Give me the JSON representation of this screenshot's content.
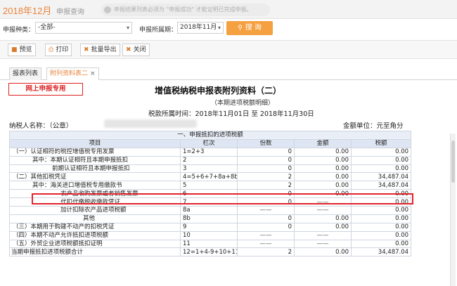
{
  "header": {
    "period": "2018年12月",
    "label": "申报查询",
    "notice": "申报结果列表必须为 \"申报成功\" 才能证明已完成申报。"
  },
  "filters": {
    "type_label": "申报种类：",
    "type_value": "-全部-",
    "month_label": "申报所属期：",
    "month_value": "2018年11月",
    "query_label": "搜 询",
    "query_icon": "search-icon"
  },
  "toolbar": {
    "preview": "预览",
    "print": "打印",
    "export": "批量导出",
    "close": "关闭"
  },
  "tabs": [
    {
      "label": "报表列表"
    },
    {
      "label": "附列资料表二"
    }
  ],
  "sheet": {
    "stamp": "网上申报专用",
    "title": "增值税纳税申报表附列资料（二）",
    "subtitle": "（本期进项税额明细）",
    "period": "税款所属时间：2018年11月01日  至  2018年11月30日",
    "taxpayer": "纳税人名称：（公章）",
    "unit": "金额单位：元至角分",
    "section": "一、申报抵扣的进项税额",
    "columns": {
      "item": "项目",
      "code": "栏次",
      "count": "份数",
      "amount": "金额",
      "tax": "税额"
    },
    "rows": [
      {
        "item": "（一）认证相符的税控增值税专用发票",
        "code": "1=2+3",
        "count": "0",
        "amount": "0.00",
        "tax": "0.00"
      },
      {
        "item": "其中：本期认证相符且本期申报抵扣",
        "code": "2",
        "count": "0",
        "amount": "0.00",
        "tax": "0.00"
      },
      {
        "item": "前期认证相符且本期申报抵扣",
        "code": "3",
        "count": "0",
        "amount": "0.00",
        "tax": "0.00"
      },
      {
        "item": "（二）其他扣税凭证",
        "code": "4=5+6+7+8a+8b",
        "count": "2",
        "amount": "0.00",
        "tax": "34,487.04"
      },
      {
        "item": "其中：海关进口增值税专用缴款书",
        "code": "5",
        "count": "2",
        "amount": "0.00",
        "tax": "34,487.04"
      },
      {
        "item": "农产品收购发票或者销售发票",
        "code": "6",
        "count": "0",
        "amount": "0.00",
        "tax": "0.00"
      },
      {
        "item": "代扣代缴税收缴款凭证",
        "code": "7",
        "count": "0",
        "amount": "——",
        "tax": "0.00"
      },
      {
        "item": "加计扣除农产品进项税额",
        "code": "8a",
        "count": "——",
        "amount": "——",
        "tax": "0.00"
      },
      {
        "item": "其他",
        "code": "8b",
        "count": "0",
        "amount": "0.00",
        "tax": "0.00"
      },
      {
        "item": "（三）本期用于购建不动产的扣税凭证",
        "code": "9",
        "count": "0",
        "amount": "0.00",
        "tax": "0.00"
      },
      {
        "item": "（四）本期不动产允许抵扣进项税额",
        "code": "10",
        "count": "——",
        "amount": "——",
        "tax": "0.00"
      },
      {
        "item": "（五）外贸企业进项税额抵扣证明",
        "code": "11",
        "count": "——",
        "amount": "——",
        "tax": "0.00"
      },
      {
        "item": "当期申报抵扣进项税额合计",
        "code": "12=1+4-9+10+11",
        "count": "2",
        "amount": "0.00",
        "tax": "34,487.04"
      }
    ]
  }
}
